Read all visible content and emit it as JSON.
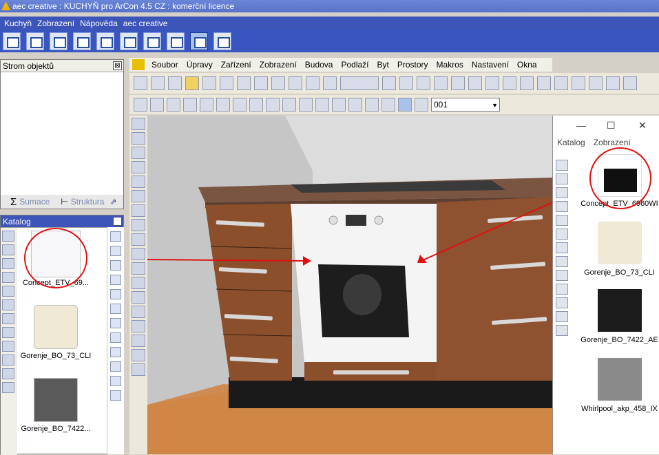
{
  "app": {
    "title": "aec creative : KUCHYŇ pro ArCon 4.5 CZ : komerční licence"
  },
  "main_menu": [
    "Kuchyň",
    "Zobrazení",
    "Nápověda",
    "aec creative"
  ],
  "panels": {
    "strom": {
      "title": "Strom objektů",
      "close": "⊠",
      "tabs": [
        "Sumace",
        "Struktura"
      ]
    },
    "katalog": {
      "title": "Katalog",
      "close": "⊠",
      "items": [
        "Concept_ETV_69...",
        "Gorenje_BO_73_CLI",
        "Gorenje_BO_7422..."
      ]
    }
  },
  "sub_menu": [
    "Soubor",
    "Úpravy",
    "Zařízení",
    "Zobrazení",
    "Budova",
    "Podlaží",
    "Byt",
    "Prostory",
    "Makros",
    "Nastavení",
    "Okna"
  ],
  "toolbar3": {
    "floor_select": "001"
  },
  "catalog_window": {
    "menu": [
      "Katalog",
      "Zobrazení"
    ],
    "controls": [
      "—",
      "☐",
      "✕"
    ],
    "items": [
      "Concept_ETV_6960WI",
      "Gorenje_BO_73_CLI",
      "Gorenje_BO_7422_AE",
      "Whirlpool_akp_458_IX"
    ]
  },
  "colors": {
    "title_bar": "#5773c9",
    "menu_bar": "#3d55b8",
    "annotation_red": "#e01010",
    "wood_cabinet": "#8b4f2c",
    "countertop": "#7a5542",
    "floor": "#d08a4a"
  }
}
